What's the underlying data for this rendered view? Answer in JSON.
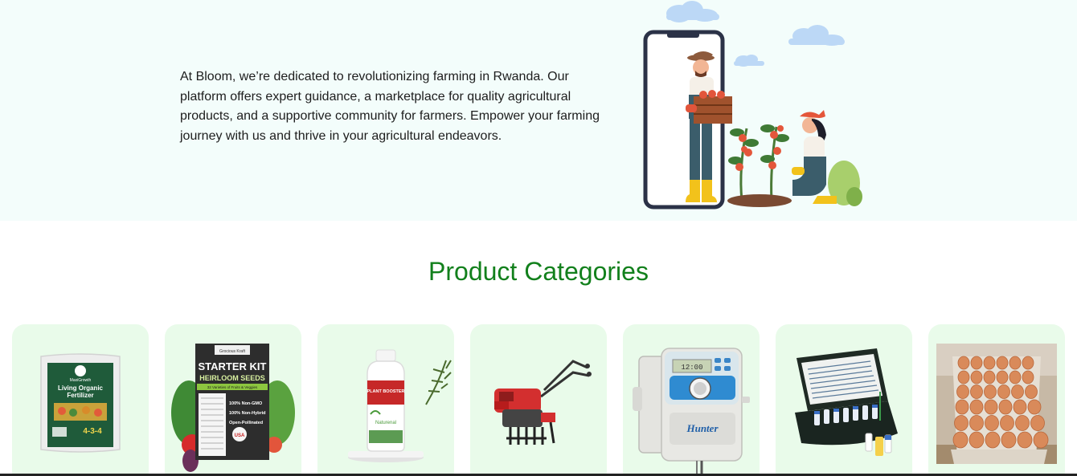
{
  "hero": {
    "description": "At Bloom, we’re dedicated to revolutionizing farming in Rwanda. Our platform offers expert guidance, a marketplace for quality agricultural products, and a supportive community for farmers. Empower your farming journey with us and thrive in your agricultural endeavors."
  },
  "categories_section": {
    "title": "Product Categories"
  },
  "products": {
    "fertilizer": {
      "brand": "MaxiGrowth",
      "line1": "Living Organic",
      "line2": "Fertilizer",
      "npk": "4-3-4"
    },
    "seeds": {
      "brand": "Grocious Kraft",
      "line1": "STARTER KIT",
      "line2": "HEIRLOOM SEEDS",
      "subtitle": "32 Varieties of Fruits & Veggies",
      "badge": "USA",
      "features": [
        "100% Non-GMO",
        "100% Non-Hybrid",
        "Open-Pollinated"
      ]
    },
    "plant_booster": {
      "label_top": "PLANT BOOSTER",
      "brand": "Naturenal"
    },
    "irrigation_controller": {
      "brand": "Hunter",
      "display": "12:00"
    }
  },
  "colors": {
    "hero_bg": "#f3fdfb",
    "title_green": "#12801c",
    "card_bg": "#e9fbea"
  }
}
